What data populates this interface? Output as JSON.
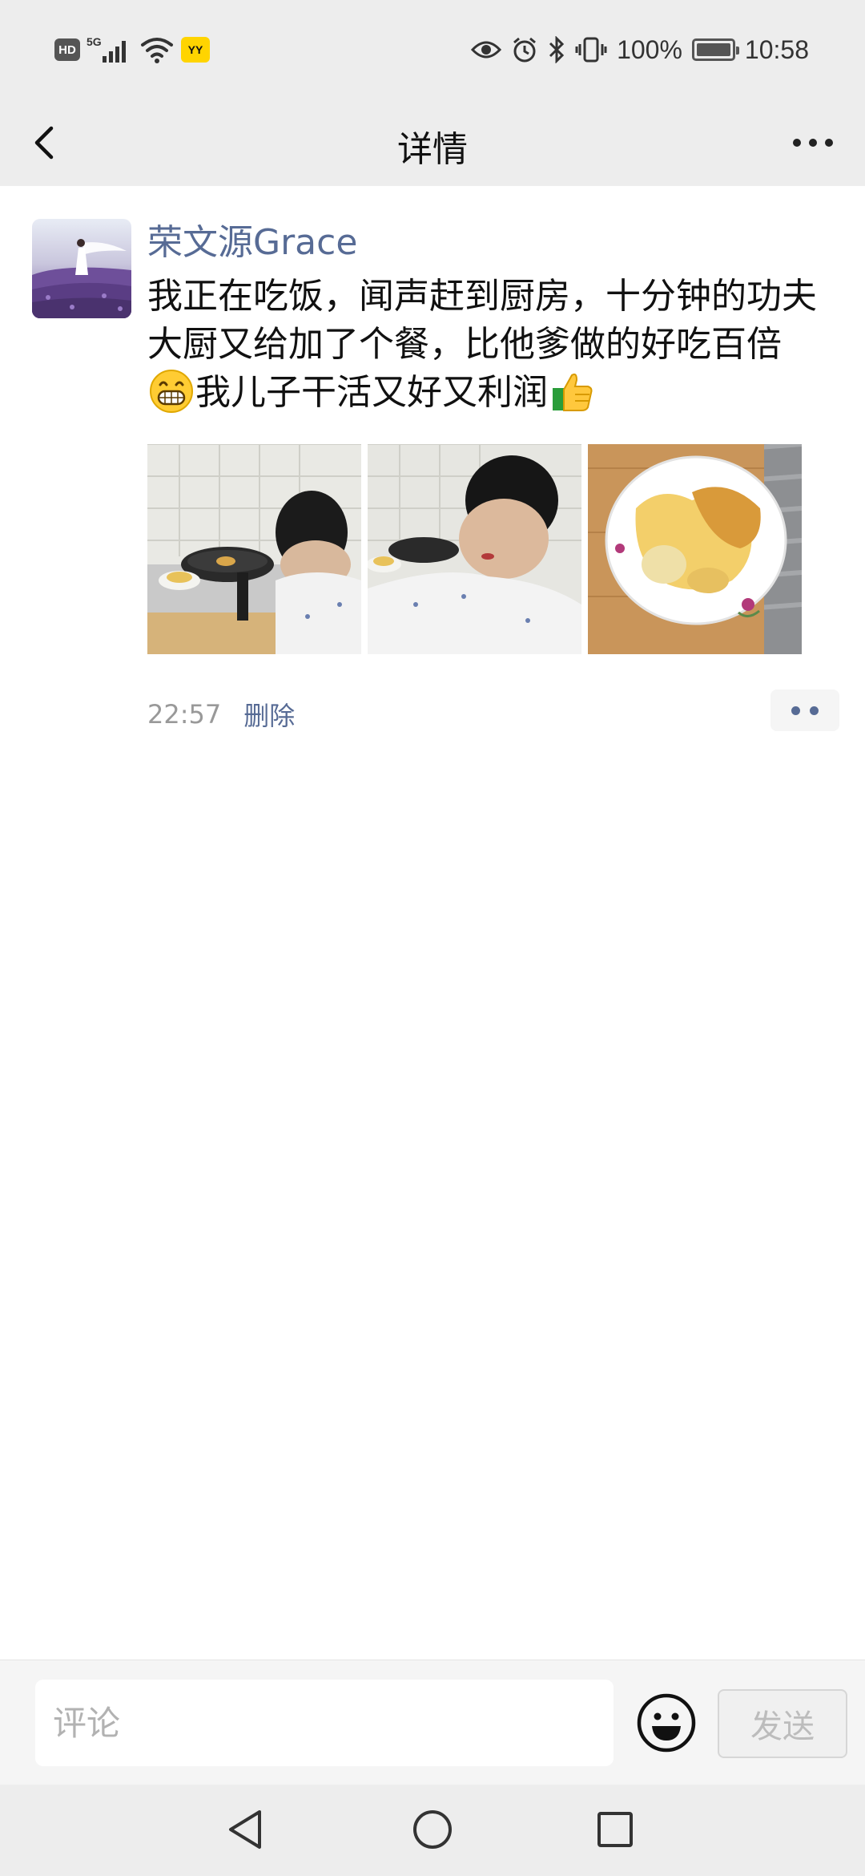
{
  "status_bar": {
    "left_badges": [
      "HD",
      "5G",
      "YY"
    ],
    "battery": "100%",
    "time": "10:58"
  },
  "header": {
    "title": "详情"
  },
  "post": {
    "author": "荣文源Grace",
    "text_part1": "我正在吃饭，闻声赶到厨房，十分钟的功夫大厨又给加了个餐，比他爹做的好吃百倍",
    "text_part2": "我儿子干活又好又利润",
    "timestamp": "22:57",
    "delete_label": "删除"
  },
  "comment_bar": {
    "placeholder": "评论",
    "send_label": "发送"
  },
  "colors": {
    "link": "#576b95",
    "bar_bg": "#ededed",
    "timestamp": "#999999"
  },
  "icons": [
    "back-arrow-icon",
    "more-icon",
    "emoji-icon",
    "nav-back-icon",
    "nav-home-icon",
    "nav-recents-icon",
    "eye-icon",
    "alarm-icon",
    "bluetooth-icon",
    "vibrate-icon",
    "wifi-icon",
    "battery-icon"
  ]
}
